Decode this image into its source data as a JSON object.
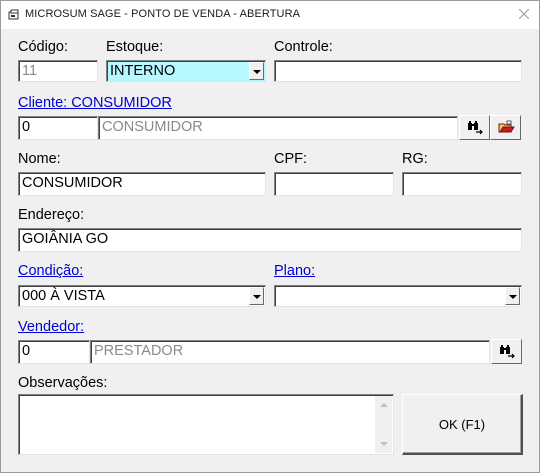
{
  "window": {
    "title": "MICROSUM SAGE - PONTO DE VENDA - ABERTURA"
  },
  "labels": {
    "codigo": "Código:",
    "estoque": "Estoque:",
    "controle": "Controle:",
    "cliente": "Cliente: CONSUMIDOR",
    "nome": "Nome:",
    "cpf": "CPF:",
    "rg": "RG:",
    "endereco": "Endereço:",
    "condicao": "Condição:",
    "plano": "Plano:",
    "vendedor": "Vendedor:",
    "observacoes": "Observações:"
  },
  "fields": {
    "codigo": "11",
    "estoque": "INTERNO",
    "controle": "",
    "cliente_code": "0",
    "cliente_name": "CONSUMIDOR",
    "nome": "CONSUMIDOR",
    "cpf": "",
    "rg": "",
    "endereco": "GOIÂNIA GO",
    "condicao": "000 À VISTA",
    "plano": "",
    "vendedor_code": "0",
    "vendedor_name": "PRESTADOR",
    "observacoes": ""
  },
  "buttons": {
    "ok": "OK (F1)"
  },
  "icons": {
    "app": "app-icon",
    "close": "close-icon",
    "search_cliente": "binoculars-icon",
    "new_cliente": "open-folder-icon",
    "search_vendedor": "binoculars-icon"
  },
  "colors": {
    "link": "#0000d8",
    "stock_highlight": "#b7f7ff",
    "readonly_text": "#8a8a8a"
  }
}
